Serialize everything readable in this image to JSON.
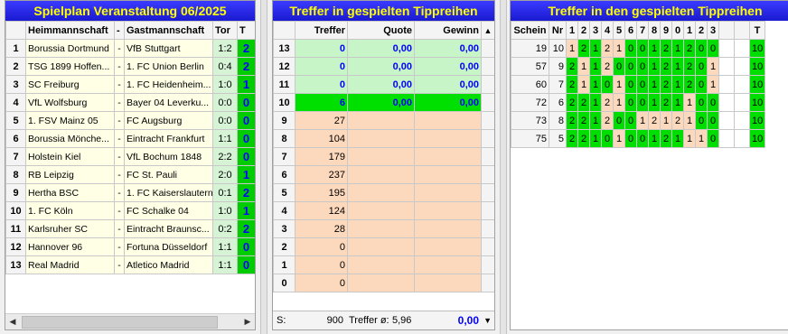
{
  "panel1": {
    "title": "Spielplan Veranstaltung 06/2025",
    "headers": {
      "home": "Heimmannschaft",
      "dash": "-",
      "away": "Gastmannschaft",
      "tor": "Tor",
      "t": "T"
    },
    "rows": [
      {
        "n": "1",
        "home": "Borussia Dortmund",
        "dash": "-",
        "away": "VfB Stuttgart",
        "tor": "1:2",
        "tip": "2"
      },
      {
        "n": "2",
        "home": "TSG 1899 Hoffen...",
        "dash": "-",
        "away": "1. FC Union Berlin",
        "tor": "0:4",
        "tip": "2"
      },
      {
        "n": "3",
        "home": "SC Freiburg",
        "dash": "-",
        "away": "1. FC Heidenheim...",
        "tor": "1:0",
        "tip": "1"
      },
      {
        "n": "4",
        "home": "VfL Wolfsburg",
        "dash": "-",
        "away": "Bayer 04 Leverku...",
        "tor": "0:0",
        "tip": "0"
      },
      {
        "n": "5",
        "home": "1. FSV Mainz 05",
        "dash": "-",
        "away": "FC Augsburg",
        "tor": "0:0",
        "tip": "0"
      },
      {
        "n": "6",
        "home": "Borussia Mönche...",
        "dash": "-",
        "away": "Eintracht Frankfurt",
        "tor": "1:1",
        "tip": "0"
      },
      {
        "n": "7",
        "home": "Holstein Kiel",
        "dash": "-",
        "away": "VfL Bochum 1848",
        "tor": "2:2",
        "tip": "0"
      },
      {
        "n": "8",
        "home": "RB Leipzig",
        "dash": "-",
        "away": "FC St. Pauli",
        "tor": "2:0",
        "tip": "1"
      },
      {
        "n": "9",
        "home": "Hertha BSC",
        "dash": "-",
        "away": "1. FC Kaiserslautern",
        "tor": "0:1",
        "tip": "2"
      },
      {
        "n": "10",
        "home": "1. FC Köln",
        "dash": "-",
        "away": "FC Schalke 04",
        "tor": "1:0",
        "tip": "1"
      },
      {
        "n": "11",
        "home": "Karlsruher SC",
        "dash": "-",
        "away": "Eintracht Braunsc...",
        "tor": "0:2",
        "tip": "2"
      },
      {
        "n": "12",
        "home": "Hannover 96",
        "dash": "-",
        "away": "Fortuna Düsseldorf",
        "tor": "1:1",
        "tip": "0"
      },
      {
        "n": "13",
        "home": "Real Madrid",
        "dash": "-",
        "away": "Atletico Madrid",
        "tor": "1:1",
        "tip": "0"
      }
    ]
  },
  "panel2": {
    "title": "Treffer in gespielten Tippreihen",
    "headers": {
      "treffer": "Treffer",
      "quote": "Quote",
      "gewinn": "Gewinn"
    },
    "rows": [
      {
        "n": "13",
        "treffer": "0",
        "quote": "0,00",
        "gewinn": "0,00",
        "style": "green"
      },
      {
        "n": "12",
        "treffer": "0",
        "quote": "0,00",
        "gewinn": "0,00",
        "style": "green"
      },
      {
        "n": "11",
        "treffer": "0",
        "quote": "0,00",
        "gewinn": "0,00",
        "style": "green"
      },
      {
        "n": "10",
        "treffer": "6",
        "quote": "0,00",
        "gewinn": "0,00",
        "style": "hl"
      },
      {
        "n": "9",
        "treffer": "27",
        "quote": "",
        "gewinn": "",
        "style": "peach"
      },
      {
        "n": "8",
        "treffer": "104",
        "quote": "",
        "gewinn": "",
        "style": "peach"
      },
      {
        "n": "7",
        "treffer": "179",
        "quote": "",
        "gewinn": "",
        "style": "peach"
      },
      {
        "n": "6",
        "treffer": "237",
        "quote": "",
        "gewinn": "",
        "style": "peach"
      },
      {
        "n": "5",
        "treffer": "195",
        "quote": "",
        "gewinn": "",
        "style": "peach"
      },
      {
        "n": "4",
        "treffer": "124",
        "quote": "",
        "gewinn": "",
        "style": "peach"
      },
      {
        "n": "3",
        "treffer": "28",
        "quote": "",
        "gewinn": "",
        "style": "peach"
      },
      {
        "n": "2",
        "treffer": "0",
        "quote": "",
        "gewinn": "",
        "style": "peach"
      },
      {
        "n": "1",
        "treffer": "0",
        "quote": "",
        "gewinn": "",
        "style": "peach"
      },
      {
        "n": "0",
        "treffer": "0",
        "quote": "",
        "gewinn": "",
        "style": "peach"
      }
    ],
    "footer": {
      "s_label": "S:",
      "sum": "900",
      "avg_label": "Treffer ø:",
      "avg": "5,96",
      "total": "0,00"
    }
  },
  "panel3": {
    "title": "Treffer in den gespielten Tippreihen",
    "headers": [
      "Schein",
      "Nr",
      "1",
      "2",
      "3",
      "4",
      "5",
      "6",
      "7",
      "8",
      "9",
      "0",
      "1",
      "2",
      "3",
      "",
      "",
      "T"
    ],
    "rows": [
      {
        "schein": "19",
        "nr": "10",
        "tips": [
          "1",
          "2",
          "1",
          "2",
          "1",
          "0",
          "0",
          "1",
          "2",
          "1",
          "2",
          "0",
          "0"
        ],
        "t": "10"
      },
      {
        "schein": "57",
        "nr": "9",
        "tips": [
          "2",
          "1",
          "1",
          "2",
          "0",
          "0",
          "0",
          "1",
          "2",
          "1",
          "2",
          "0",
          "1"
        ],
        "t": "10"
      },
      {
        "schein": "60",
        "nr": "7",
        "tips": [
          "2",
          "1",
          "1",
          "0",
          "1",
          "0",
          "0",
          "1",
          "2",
          "1",
          "2",
          "0",
          "1"
        ],
        "t": "10"
      },
      {
        "schein": "72",
        "nr": "6",
        "tips": [
          "2",
          "2",
          "1",
          "2",
          "1",
          "0",
          "0",
          "1",
          "2",
          "1",
          "1",
          "0",
          "0"
        ],
        "t": "10"
      },
      {
        "schein": "73",
        "nr": "8",
        "tips": [
          "2",
          "2",
          "1",
          "2",
          "0",
          "0",
          "1",
          "2",
          "1",
          "2",
          "1",
          "0",
          "0"
        ],
        "t": "10"
      },
      {
        "schein": "75",
        "nr": "5",
        "tips": [
          "2",
          "2",
          "1",
          "0",
          "1",
          "0",
          "0",
          "1",
          "2",
          "1",
          "1",
          "1",
          "0"
        ],
        "t": "10"
      }
    ]
  },
  "colors": {
    "title_bg": "#2a2ae8",
    "title_text": "#ffff00",
    "hit_green": "#00dd00",
    "miss_peach": "#fcd8bc"
  }
}
